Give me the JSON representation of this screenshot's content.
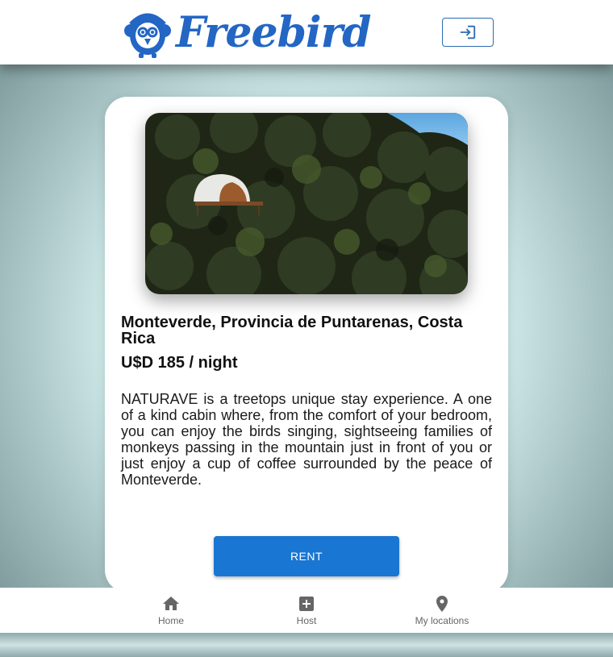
{
  "brand": {
    "name": "Freebird",
    "color": "#2366c4"
  },
  "header": {
    "login_icon": "login-icon"
  },
  "listing": {
    "location": "Monteverde, Provincia de Puntarenas, Costa Rica",
    "price": "U$D 185 / night",
    "description": "NATURAVE is a treetops unique stay experience. A one of a kind cabin where, from the comfort of your bedroom, you can enjoy the birds singing, sightseeing families of monkeys passing in the mountain just in front of you or just enjoy a cup of coffee surrounded by the peace of Monteverde.",
    "rent_label": "RENT",
    "image_alt": "Dome cabin in treetops"
  },
  "nav": {
    "items": [
      {
        "label": "Home",
        "icon": "home-icon"
      },
      {
        "label": "Host",
        "icon": "add-box-icon"
      },
      {
        "label": "My locations",
        "icon": "location-pin-icon"
      }
    ]
  },
  "colors": {
    "accent": "#1976d2",
    "background": "#cfe9e9",
    "card": "#ffffff"
  }
}
